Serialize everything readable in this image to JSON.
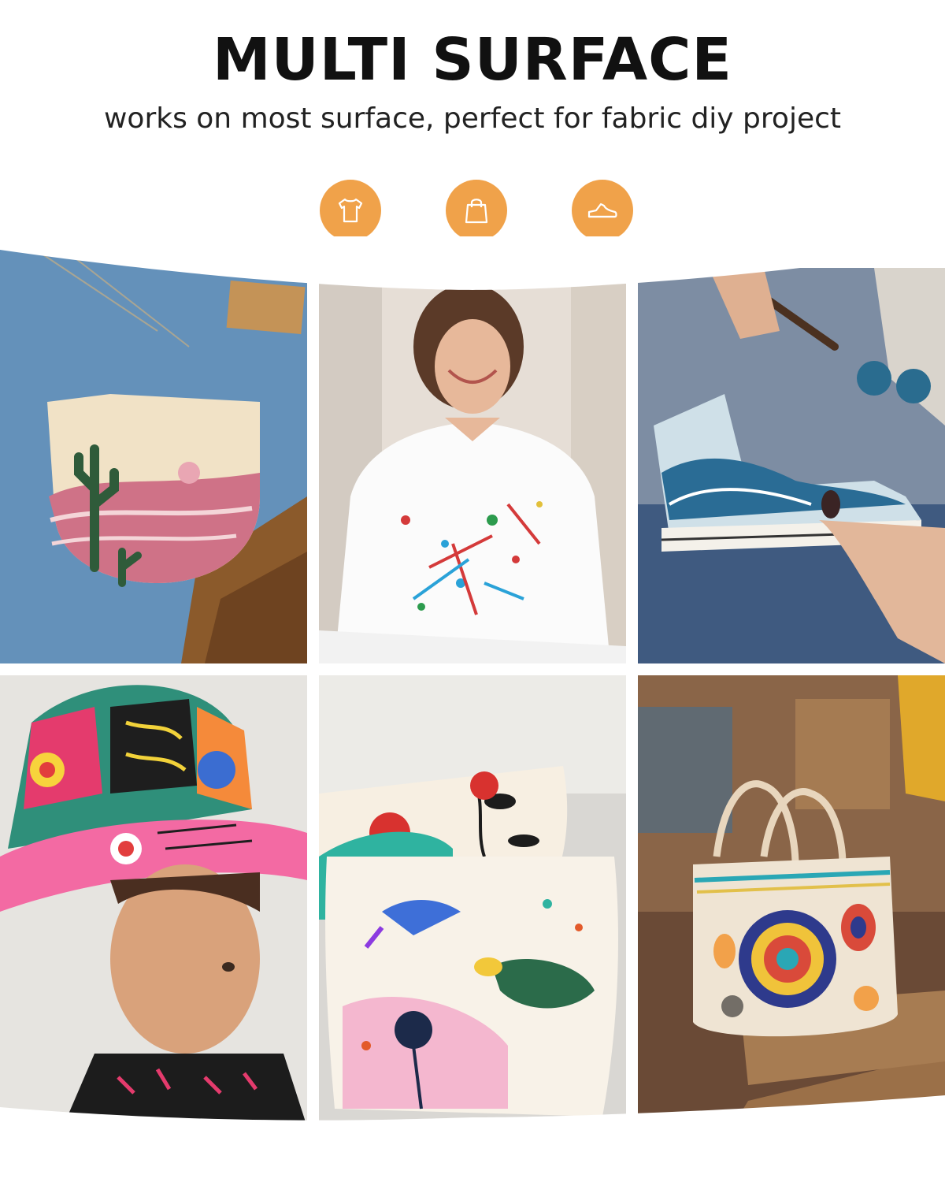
{
  "header": {
    "title": "MULTI SURFACE",
    "subtitle": "works on most surface, perfect for fabric diy project"
  },
  "icons": [
    {
      "name": "tshirt-icon",
      "color": "#f0a24a"
    },
    {
      "name": "shopping-bag-icon",
      "color": "#f0a24a"
    },
    {
      "name": "sneaker-icon",
      "color": "#f0a24a"
    }
  ],
  "colors": {
    "accent": "#f0a24a",
    "background": "#ffffff",
    "title": "#111111"
  },
  "photos": [
    {
      "name": "denim-pocket-photo"
    },
    {
      "name": "splatter-tshirt-photo"
    },
    {
      "name": "painted-sneaker-photo"
    },
    {
      "name": "painted-bucket-hat-photo"
    },
    {
      "name": "painted-pillows-photo"
    },
    {
      "name": "painted-tote-bag-photo"
    }
  ]
}
